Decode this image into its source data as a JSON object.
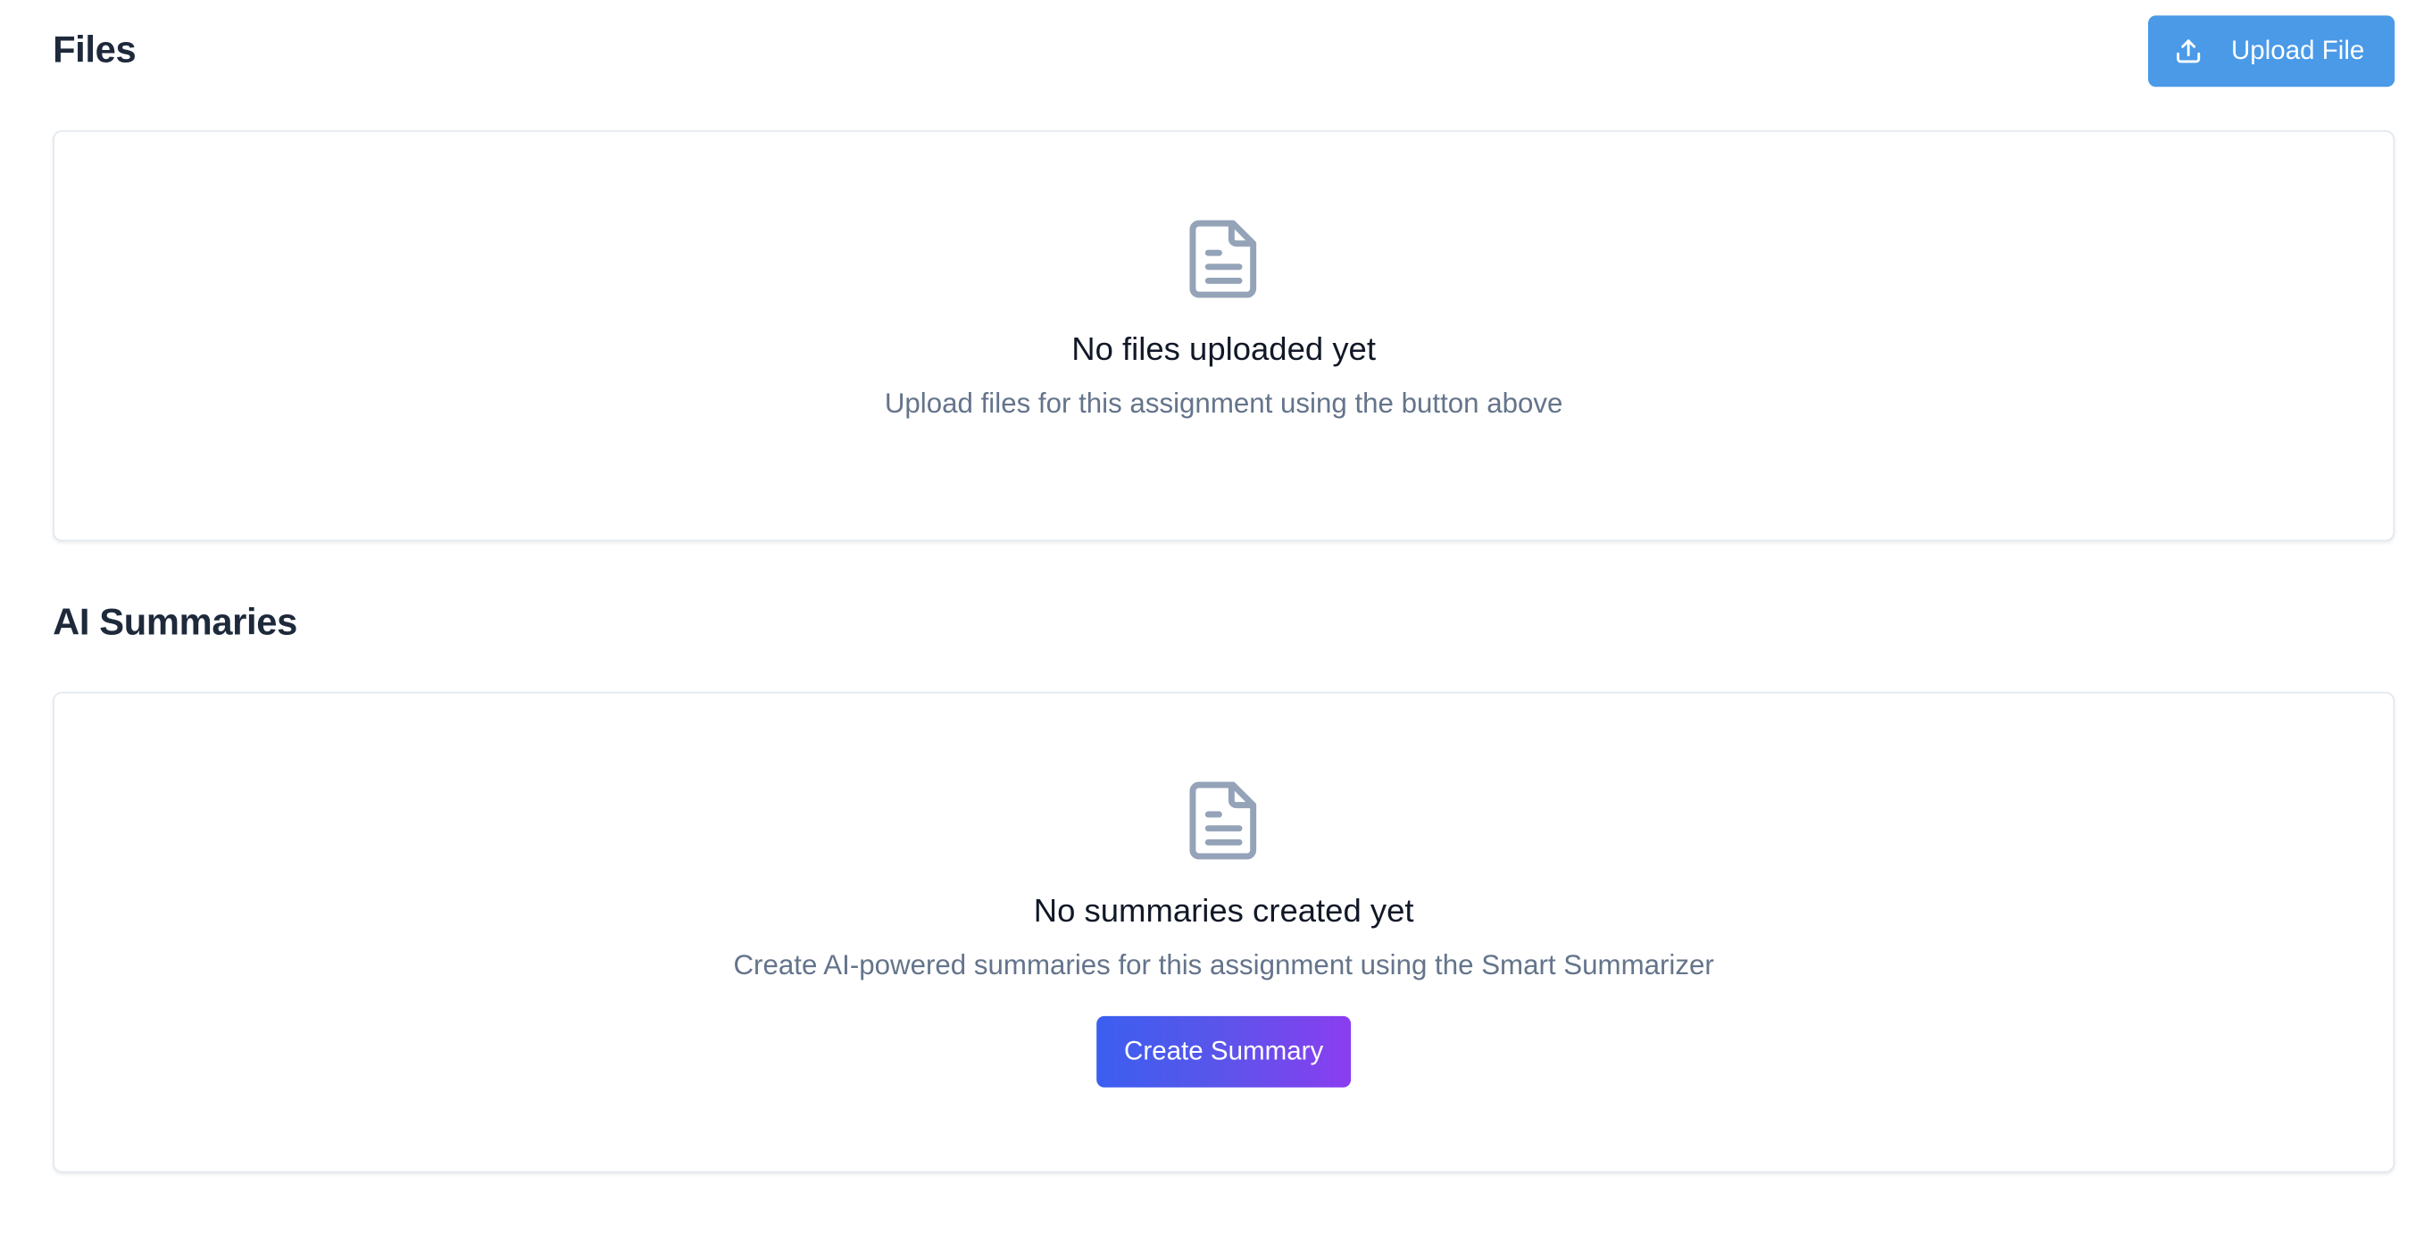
{
  "files": {
    "title": "Files",
    "upload_button_label": "Upload File",
    "upload_icon": "upload-icon",
    "empty_icon": "document-icon",
    "empty_title": "No files uploaded yet",
    "empty_text": "Upload files for this assignment using the button above"
  },
  "ai_summaries": {
    "title": "AI Summaries",
    "empty_icon": "document-icon",
    "empty_title": "No summaries created yet",
    "empty_text": "Create AI-powered summaries for this assignment using the Smart Summarizer",
    "create_button_label": "Create Summary"
  },
  "colors": {
    "primary_button": "#4a9ae8",
    "gradient_start": "#3b5ff0",
    "gradient_end": "#8b3df0",
    "heading_text": "#1e293b",
    "muted_text": "#64748b",
    "icon_gray": "#94a3b8",
    "border": "#e2e8f0"
  }
}
